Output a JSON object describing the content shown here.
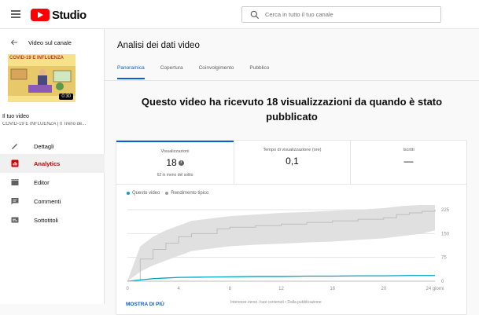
{
  "header": {
    "logo_text": "Studio",
    "search_placeholder": "Cerca in tutto il tuo canale"
  },
  "sidebar": {
    "back_label": "Video sul canale",
    "thumbnail": {
      "title": "COVID-19 E INFLUENZA",
      "duration": "0:30"
    },
    "video_title": "Il tuo video",
    "video_subtitle": "COVID-19 E INFLUENZA | Il Treno de...",
    "items": [
      {
        "label": "Dettagli",
        "icon": "pencil-icon",
        "active": false
      },
      {
        "label": "Analytics",
        "icon": "analytics-icon",
        "active": true
      },
      {
        "label": "Editor",
        "icon": "clapperboard-icon",
        "active": false
      },
      {
        "label": "Commenti",
        "icon": "comment-icon",
        "active": false
      },
      {
        "label": "Sottotitoli",
        "icon": "subtitles-icon",
        "active": false
      }
    ]
  },
  "main": {
    "title": "Analisi dei dati video",
    "tabs": [
      {
        "label": "Panoramica",
        "active": true
      },
      {
        "label": "Copertura",
        "active": false
      },
      {
        "label": "Coinvolgimento",
        "active": false
      },
      {
        "label": "Pubblico",
        "active": false
      }
    ],
    "headline": "Questo video ha ricevuto 18 visualizzazioni da quando è stato pubblicato",
    "metrics": [
      {
        "label": "Visualizzazioni",
        "value": "18",
        "note": "62 in meno del solito",
        "active": true
      },
      {
        "label": "Tempo di visualizzazione (ore)",
        "value": "0,1",
        "note": "",
        "active": false
      },
      {
        "label": "Iscritti",
        "value": "—",
        "note": "",
        "active": false
      }
    ],
    "more_label": "MOSTRA DI PIÙ",
    "footer_note": "Interesse verso i tuoi contenuti • Dalla pubblicazione"
  },
  "colors": {
    "accent": "#065fd4",
    "brand": "#ff0000",
    "this_video": "#00a3c4",
    "typical": "#bdbdbd",
    "typical_band": "#e0e0e0"
  },
  "chart_data": {
    "type": "line",
    "legend": [
      "Questo video",
      "Rendimento tipico"
    ],
    "x_ticks": [
      "0",
      "4",
      "8",
      "12",
      "16",
      "20",
      "24 giorni"
    ],
    "y_ticks": [
      "225",
      "150",
      "75",
      "0"
    ],
    "ylim": [
      0,
      225
    ],
    "xlim": [
      0,
      24
    ],
    "series": [
      {
        "name": "Questo video",
        "x": [
          0,
          1,
          2,
          3,
          4,
          6,
          8,
          10,
          12,
          14,
          16,
          18,
          20,
          22,
          24
        ],
        "values": [
          0,
          4,
          8,
          10,
          12,
          13,
          14,
          15,
          15,
          16,
          16,
          17,
          17,
          18,
          18
        ]
      },
      {
        "name": "Rendimento tipico",
        "x": [
          0,
          1,
          2,
          3,
          4,
          5,
          7,
          8,
          10,
          12,
          14,
          16,
          18,
          20,
          21,
          22,
          23,
          24
        ],
        "values": [
          0,
          70,
          100,
          120,
          140,
          150,
          165,
          170,
          175,
          180,
          185,
          190,
          195,
          200,
          210,
          215,
          220,
          225
        ],
        "low": [
          0,
          30,
          50,
          65,
          80,
          95,
          105,
          110,
          115,
          118,
          122,
          125,
          130,
          135,
          140,
          145,
          150,
          160
        ],
        "high": [
          0,
          110,
          140,
          160,
          175,
          190,
          200,
          205,
          210,
          215,
          218,
          222,
          225,
          230,
          235,
          238,
          240,
          245
        ]
      }
    ],
    "grid": true
  }
}
